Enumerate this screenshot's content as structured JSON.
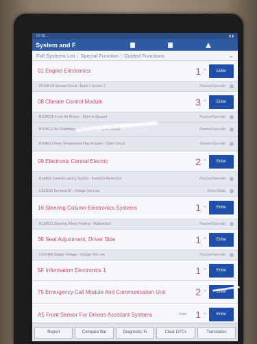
{
  "app": {
    "title": "System and F",
    "status_time": "07:38 ..."
  },
  "tabs": [
    "Full Systems List",
    "Special Function",
    "Guided Functions"
  ],
  "systems": [
    {
      "name": "01 Engine Electronics",
      "count": "1",
      "enter": "Enter",
      "dtcs": [
        {
          "desc": "P0158 O2 Sensor Circuit - Bank 1 Sensor 2",
          "status": "Passive/Sporadic"
        }
      ]
    },
    {
      "name": "08 Climate Control Module",
      "count": "3",
      "enter": "Enter",
      "dtcs": [
        {
          "desc": "B10AD11 Fresh Air Blower - Short to Ground",
          "status": "Passive/Sporadic"
        },
        {
          "desc": "B10AE13 Air Distribution Flap Actuator - Open Circuit",
          "status": "Passive/Sporadic"
        },
        {
          "desc": "B10AF13 Rear Temperature Flap Actuator - Open Circuit",
          "status": "Passive/Sporadic"
        }
      ]
    },
    {
      "name": "09 Electronic Central Electric",
      "count": "2",
      "enter": "Enter",
      "dtcs": [
        {
          "desc": "B1AB26 Central Locking System - Function Restricted",
          "status": "Passive/Sporadic"
        },
        {
          "desc": "U101100 Terminal 30 - Voltage Too Low",
          "status": "Active/Static"
        }
      ]
    },
    {
      "name": "16 Steering Column Electronics Systems",
      "count": "1",
      "enter": "Enter",
      "dtcs": [
        {
          "desc": "B13A521 Steering Wheel Heating - Malfunction",
          "status": "Passive/Sporadic"
        }
      ]
    },
    {
      "name": "36 Seat Adjustment, Driver Side",
      "count": "1",
      "enter": "Enter",
      "dtcs": [
        {
          "desc": "U101400 Supply Voltage - Voltage Too Low",
          "status": "Passive/Sporadic"
        }
      ]
    },
    {
      "name": "5F Information Electronics 1",
      "count": "1",
      "enter": "Enter",
      "dtcs": []
    },
    {
      "name": "75 Emergency Call Module And Communication Unit",
      "count": "2",
      "enter": "Enter",
      "dtcs": []
    },
    {
      "name": "A5 Front Sensor For Drivers Assistant Systems",
      "count": "1",
      "enter": "Enter",
      "extra": "Static",
      "dtcs": []
    }
  ],
  "bottom_buttons": [
    "Report",
    "Compare Bar",
    "Diagnostic Fi",
    "Clear DTCs",
    "Translation"
  ],
  "colors": {
    "accent": "#2e5aa1",
    "fault_text": "#c2506a",
    "enter_button": "#1f4fa8"
  }
}
